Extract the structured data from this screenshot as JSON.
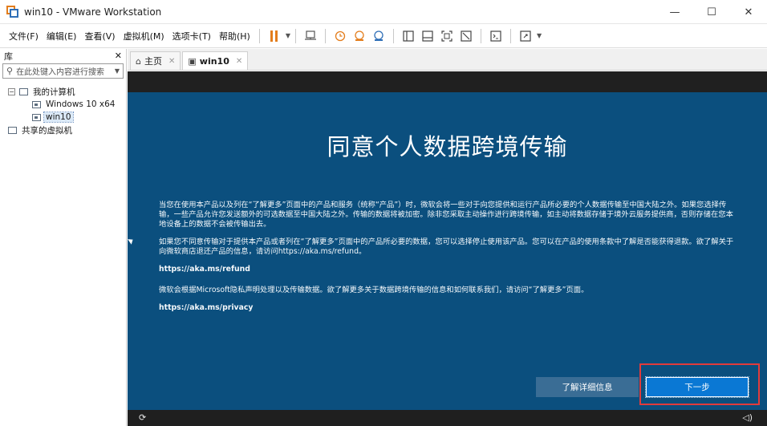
{
  "window": {
    "title": "win10 - VMware Workstation",
    "minimize": "—",
    "maximize": "☐",
    "close": "✕"
  },
  "menu": {
    "items": [
      "文件(F)",
      "编辑(E)",
      "查看(V)",
      "虚拟机(M)",
      "选项卡(T)",
      "帮助(H)"
    ]
  },
  "library": {
    "title": "库",
    "close": "✕",
    "search_placeholder": "在此处键入内容进行搜索",
    "tree": {
      "my_computer": "我的计算机",
      "vm1": "Windows 10 x64",
      "vm2": "win10",
      "shared": "共享的虚拟机"
    }
  },
  "tabs": [
    {
      "label": "主页",
      "icon": "home-icon"
    },
    {
      "label": "win10",
      "icon": "vm-icon"
    }
  ],
  "oobe": {
    "title": "同意个人数据跨境传输",
    "para1": "当您在使用本产品以及列在“了解更多”页面中的产品和服务（统称“产品”）时，微软会将一些对于向您提供和运行产品所必要的个人数据传输至中国大陆之外。如果您选择传输，一些产品允许您发送额外的可选数据至中国大陆之外。传输的数据将被加密。除非您采取主动操作进行跨境传输，如主动将数据存储于境外云服务提供商，否则存储在您本地设备上的数据不会被传输出去。",
    "para2": "如果您不同意传输对于提供本产品或者列在“了解更多”页面中的产品所必要的数据，您可以选择停止使用该产品。您可以在产品的使用条款中了解是否能获得退款。欲了解关于向微软商店退还产品的信息，请访问https://aka.ms/refund。",
    "link1": "https://aka.ms/refund",
    "para3": "微软会根据Microsoft隐私声明处理以及传输数据。欲了解更多关于数据跨境传输的信息和如何联系我们，请访问“了解更多”页面。",
    "link2": "https://aka.ms/privacy",
    "learn_more_button": "了解详细信息",
    "next_button": "下一步"
  },
  "colors": {
    "oobe_background": "#0b4f7e",
    "next_button": "#0a78d4",
    "learn_more_button": "#3a6d95",
    "highlight": "#e23b3b",
    "pause_orange": "#e37d1c"
  }
}
